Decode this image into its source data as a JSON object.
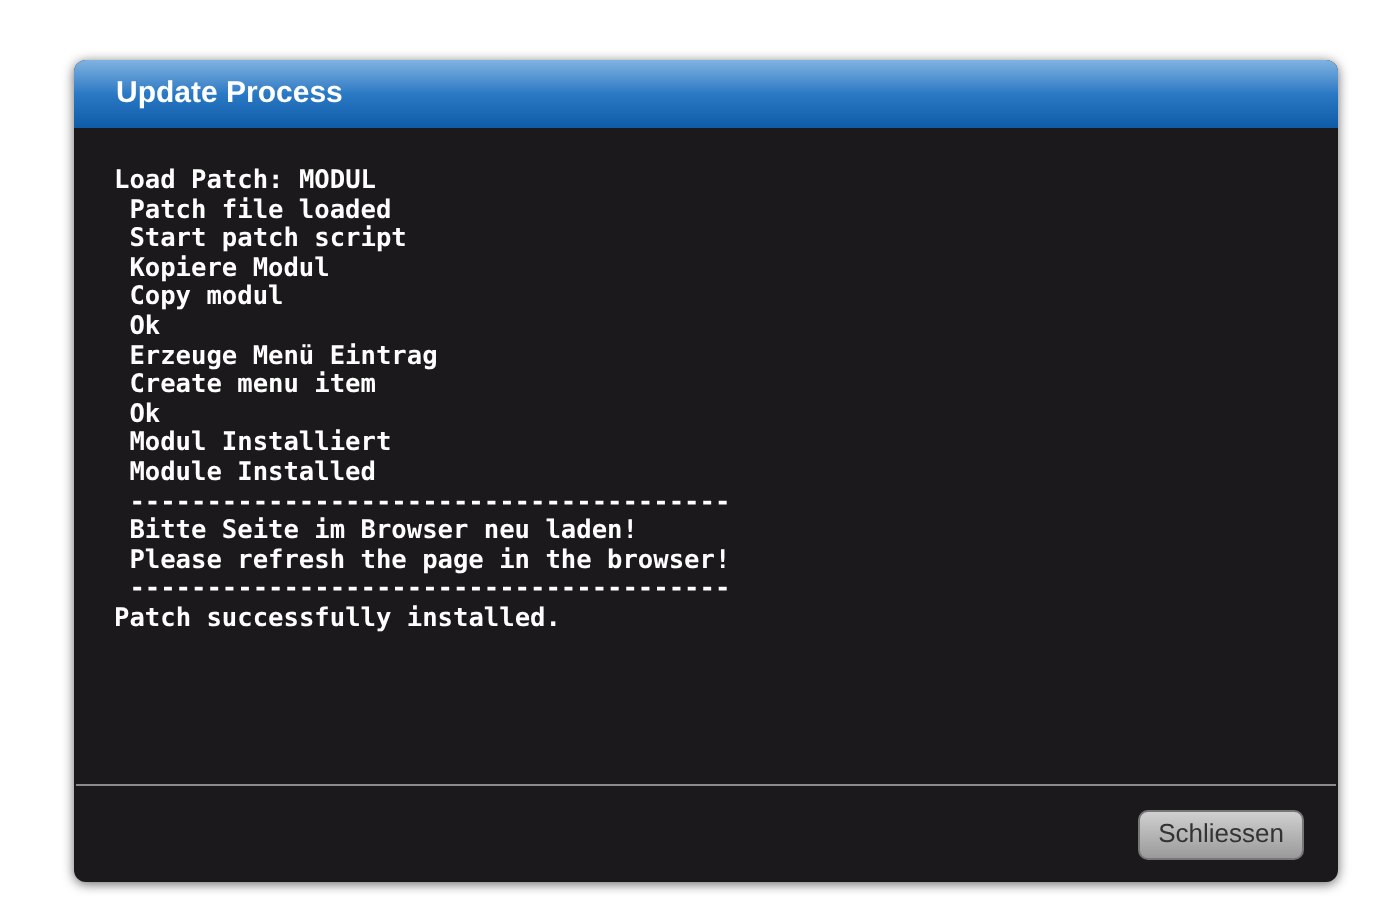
{
  "dialog": {
    "title": "Update Process",
    "log": [
      {
        "kind": "plain",
        "text": "Load Patch: MODUL"
      },
      {
        "kind": "indented",
        "text": "Patch file loaded"
      },
      {
        "kind": "indented",
        "text": "Start patch script"
      },
      {
        "kind": "indented",
        "text": "Kopiere Modul"
      },
      {
        "kind": "indented",
        "text": "Copy modul"
      },
      {
        "kind": "indented",
        "text": "Ok"
      },
      {
        "kind": "indented",
        "text": "Erzeuge Menü Eintrag"
      },
      {
        "kind": "indented",
        "text": "Create menu item"
      },
      {
        "kind": "indented",
        "text": "Ok"
      },
      {
        "kind": "indented",
        "text": "Modul Installiert"
      },
      {
        "kind": "indented",
        "text": "Module Installed"
      },
      {
        "kind": "indented",
        "text": "---------------------------------------"
      },
      {
        "kind": "indented",
        "text": "Bitte Seite im Browser neu laden!"
      },
      {
        "kind": "indented",
        "text": "Please refresh the page in the browser!"
      },
      {
        "kind": "indented",
        "text": "---------------------------------------"
      },
      {
        "kind": "plain",
        "text": "Patch successfully installed."
      }
    ],
    "buttons": [
      "Schliessen"
    ]
  }
}
